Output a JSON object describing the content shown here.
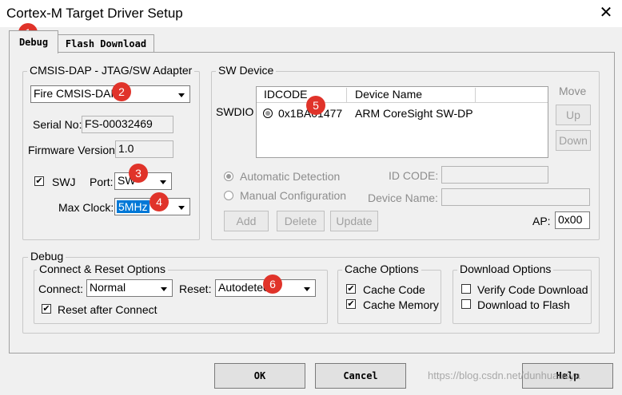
{
  "window": {
    "title": "Cortex-M Target Driver Setup",
    "close_glyph": "✕"
  },
  "tabs": [
    {
      "label": "Debug",
      "active": true
    },
    {
      "label": "Flash Download",
      "active": false
    }
  ],
  "adapter": {
    "legend": "CMSIS-DAP - JTAG/SW Adapter",
    "selected": "Fire CMSIS-DAP",
    "serial_label": "Serial No:",
    "serial_value": "FS-00032469",
    "firmware_label": "Firmware Version:",
    "firmware_value": "1.0",
    "swj_label": "SWJ",
    "swj_checked": true,
    "port_label": "Port:",
    "port_value": "SW",
    "clock_label": "Max Clock:",
    "clock_value": "5MHz"
  },
  "sw_device": {
    "legend": "SW Device",
    "swdio_label": "SWDIO",
    "columns": [
      "IDCODE",
      "Device Name"
    ],
    "rows": [
      {
        "idcode": "0x1BA01477",
        "device_name": "ARM CoreSight SW-DP"
      }
    ],
    "move_label": "Move",
    "up_label": "Up",
    "down_label": "Down",
    "auto_detect_label": "Automatic Detection",
    "manual_config_label": "Manual Configuration",
    "id_code_label": "ID CODE:",
    "device_name_label": "Device Name:",
    "add_label": "Add",
    "delete_label": "Delete",
    "update_label": "Update",
    "ap_label": "AP:",
    "ap_value": "0x00"
  },
  "debug": {
    "legend": "Debug",
    "connect_reset": {
      "legend": "Connect & Reset Options",
      "connect_label": "Connect:",
      "connect_value": "Normal",
      "reset_label": "Reset:",
      "reset_value": "Autodetect",
      "reset_after_label": "Reset after Connect",
      "reset_after_checked": true
    },
    "cache": {
      "legend": "Cache Options",
      "cache_code_label": "Cache Code",
      "cache_code_checked": true,
      "cache_memory_label": "Cache Memory",
      "cache_memory_checked": true
    },
    "download": {
      "legend": "Download Options",
      "verify_label": "Verify Code Download",
      "verify_checked": false,
      "to_flash_label": "Download to Flash",
      "to_flash_checked": false
    }
  },
  "footer": {
    "ok_label": "OK",
    "cancel_label": "Cancel",
    "help_label": "Help",
    "watermark": "https://blog.csdn.net/dunhuausya"
  },
  "annotations": [
    "1",
    "2",
    "3",
    "4",
    "5",
    "6"
  ],
  "colors": {
    "badge": "#e0332a",
    "selection": "#0078d7"
  }
}
